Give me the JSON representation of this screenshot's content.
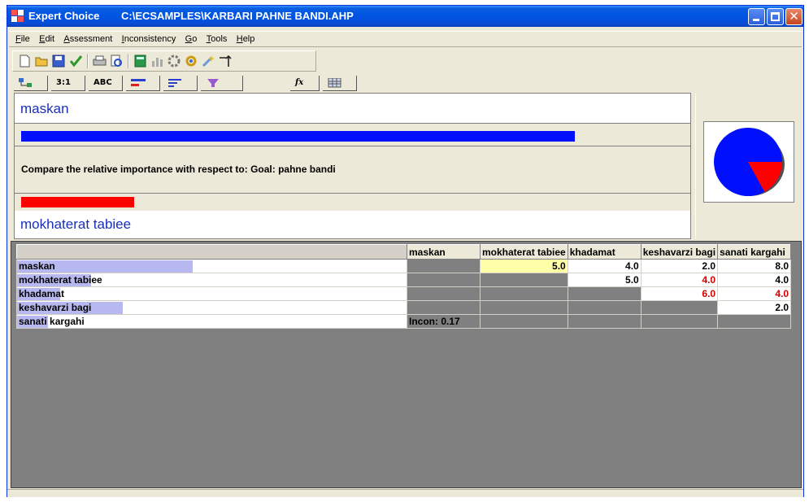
{
  "window": {
    "app_name": "Expert Choice",
    "file_path": "C:\\ECSAMPLES\\KARBARI PAHNE BANDI.AHP"
  },
  "menu": [
    "File",
    "Edit",
    "Assessment",
    "Inconsistency",
    "Go",
    "Tools",
    "Help"
  ],
  "toolbar": {
    "icons": [
      "new-icon",
      "open-icon",
      "save-icon",
      "check-icon",
      "print-icon",
      "preview-icon",
      "calculator-icon",
      "chart-icon",
      "gear-icon",
      "refresh-icon",
      "wand-icon",
      "arrow-icon"
    ]
  },
  "tabs": [
    {
      "label": "",
      "icon": "tree-icon"
    },
    {
      "label": "3:1",
      "icon": ""
    },
    {
      "label": "ABC",
      "icon": ""
    },
    {
      "label": "",
      "icon": "bars-icon"
    },
    {
      "label": "",
      "icon": "list-icon"
    },
    {
      "label": "",
      "icon": "filter-icon"
    },
    {
      "label": "fx",
      "icon": ""
    },
    {
      "label": "",
      "icon": "grid-icon"
    }
  ],
  "compare": {
    "node_a": "maskan",
    "node_b": "mokhaterat tabiee",
    "question": "Compare the relative importance with respect to: Goal: pahne bandi",
    "bar_a_fraction": 0.83,
    "bar_b_fraction": 0.17,
    "color_a": "#0010ff",
    "color_b": "#ff0000"
  },
  "matrix": {
    "columns": [
      "maskan",
      "mokhaterat tabiee",
      "khadamat",
      "keshavarzi bagi",
      "sanati kargahi"
    ],
    "rows": [
      {
        "label": "maskan",
        "weight": 0.45,
        "cells": [
          "",
          "5.0",
          "4.0",
          "2.0",
          "8.0"
        ],
        "inverted": [
          false,
          false,
          false,
          false,
          false
        ]
      },
      {
        "label": "mokhaterat tabiee",
        "weight": 0.19,
        "cells": [
          "",
          "",
          "5.0",
          "4.0",
          "4.0"
        ],
        "inverted": [
          false,
          false,
          false,
          true,
          false
        ]
      },
      {
        "label": "khadamat",
        "weight": 0.11,
        "cells": [
          "",
          "",
          "",
          "6.0",
          "4.0"
        ],
        "inverted": [
          false,
          false,
          false,
          true,
          true
        ]
      },
      {
        "label": "keshavarzi bagi",
        "weight": 0.27,
        "cells": [
          "",
          "",
          "",
          "",
          "2.0"
        ],
        "inverted": [
          false,
          false,
          false,
          false,
          false
        ]
      },
      {
        "label": "sanati kargahi",
        "weight": 0.08,
        "cells": [
          "",
          "",
          "",
          "",
          ""
        ],
        "inverted": [
          false,
          false,
          false,
          false,
          false
        ]
      }
    ],
    "inconsistency": "Incon: 0.17",
    "selected_cell": {
      "row": 0,
      "col": 1
    }
  }
}
